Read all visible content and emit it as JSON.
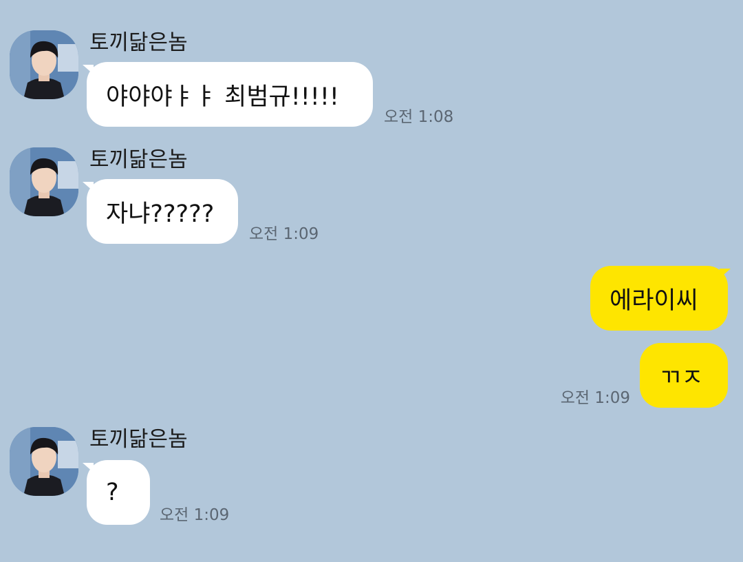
{
  "chat": {
    "messages": [
      {
        "sender": "토끼닮은놈",
        "text": "야야야ㅑㅑ 최범규!!!!!",
        "time": "오전 1:08"
      },
      {
        "sender": "토끼닮은놈",
        "text": "자냐?????",
        "time": "오전 1:09"
      },
      {
        "text": "에라이씨"
      },
      {
        "text": "ㄲㅈ",
        "time": "오전 1:09"
      },
      {
        "sender": "토끼닮은놈",
        "text": "?",
        "time": "오전 1:09"
      }
    ]
  },
  "colors": {
    "background": "#b2c7da",
    "incoming_bubble": "#ffffff",
    "outgoing_bubble": "#fee500"
  },
  "icons": {
    "avatar": "profile-photo-icon"
  }
}
